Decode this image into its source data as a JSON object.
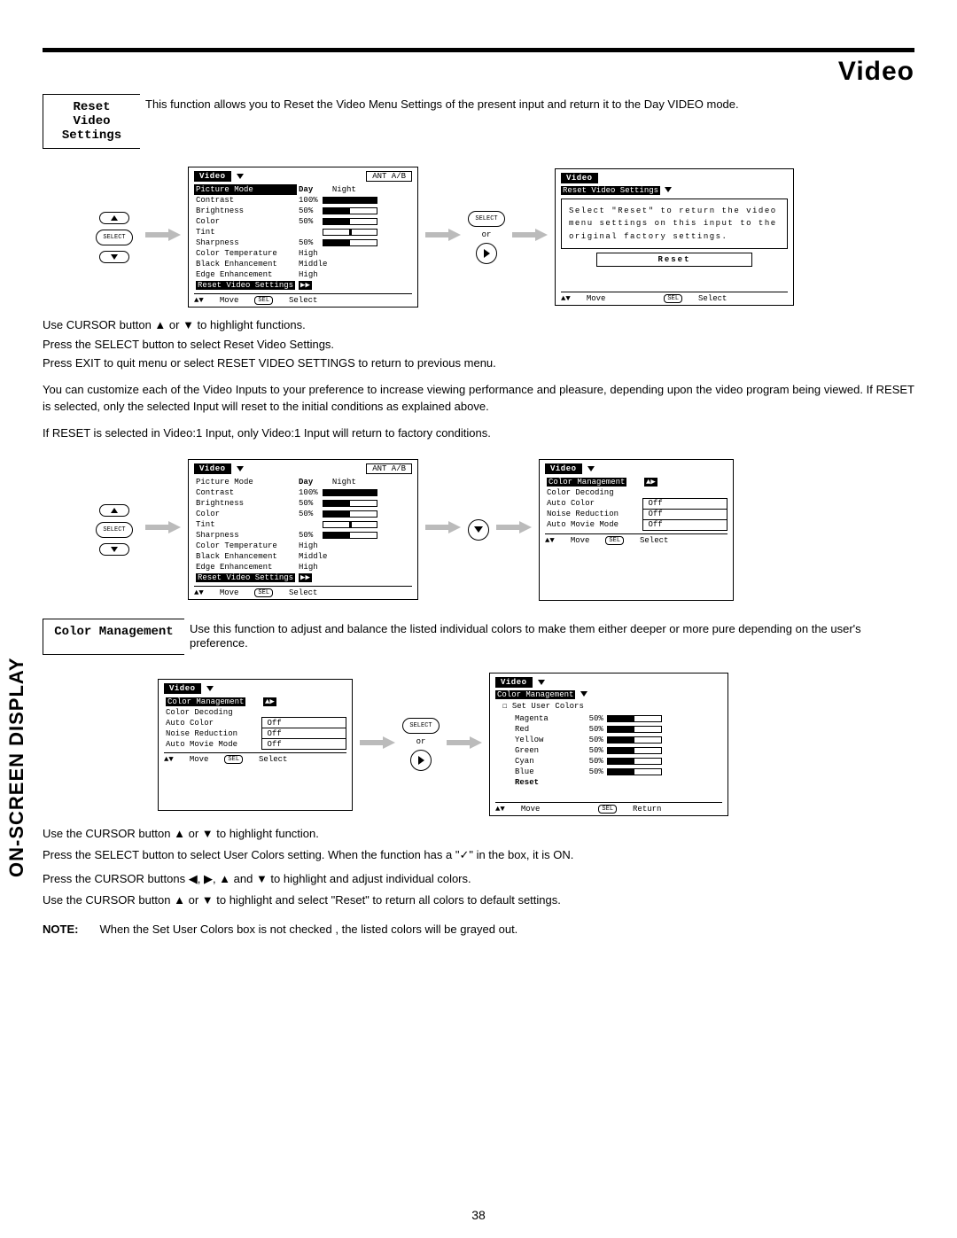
{
  "page": {
    "number": "38",
    "title": "Video",
    "sidebar": "ON-SCREEN DISPLAY"
  },
  "section1": {
    "heading": "Reset Video\nSettings",
    "intro": "This function allows you to Reset the Video Menu Settings of the present input and return it to the Day VIDEO mode.",
    "steps": [
      "Use CURSOR button ▲ or ▼ to highlight functions.",
      "Press the SELECT button to select Reset Video Settings.",
      "Press EXIT to quit menu or select RESET VIDEO SETTINGS to return to previous menu."
    ],
    "para1": "You can customize each of the Video Inputs to your preference to increase viewing performance and pleasure, depending upon the video program being viewed. If RESET is selected, only the selected Input will reset to the initial conditions as explained above.",
    "para2": "If RESET is selected in Video:1 Input, only Video:1 Input will return to factory conditions."
  },
  "osd_video": {
    "title": "Video",
    "source": "ANT A/B",
    "picture_mode_label": "Picture Mode",
    "day": "Day",
    "night": "Night",
    "rows": [
      {
        "label": "Contrast",
        "val": "100%",
        "pct": 100
      },
      {
        "label": "Brightness",
        "val": "50%",
        "pct": 50
      },
      {
        "label": "Color",
        "val": "50%",
        "pct": 50
      },
      {
        "label": "Tint",
        "val": "",
        "pct": null,
        "notch": 50
      },
      {
        "label": "Sharpness",
        "val": "50%",
        "pct": 50
      }
    ],
    "textrows": [
      {
        "label": "Color Temperature",
        "val": "High"
      },
      {
        "label": "Black Enhancement",
        "val": "Middle"
      },
      {
        "label": "Edge Enhancement",
        "val": "High"
      }
    ],
    "reset_label": "Reset Video Settings",
    "nav_move": "Move",
    "nav_select": "Select",
    "sel": "SEL",
    "updown": "▲▼"
  },
  "osd_reset": {
    "title": "Video",
    "sub": "Reset Video Settings",
    "msg": "Select \"Reset\" to return the video menu settings on this input to the original factory settings.",
    "reset": "Reset",
    "move": "Move",
    "select": "Select",
    "sel": "SEL"
  },
  "osd_cm_menu": {
    "title": "Video",
    "sub": "Color Management",
    "items": [
      {
        "label": "Color Decoding",
        "val": ""
      },
      {
        "label": "Auto Color",
        "val": "Off"
      },
      {
        "label": "Noise Reduction",
        "val": "Off"
      },
      {
        "label": "Auto Movie Mode",
        "val": "Off"
      }
    ],
    "nav_move": "Move",
    "nav_select": "Select",
    "sel": "SEL"
  },
  "osd_user_colors": {
    "title": "Video",
    "sub": "Color Management",
    "checkbox": "Set User Colors",
    "colors": [
      {
        "label": "Magenta",
        "val": "50%",
        "pct": 50
      },
      {
        "label": "Red",
        "val": "50%",
        "pct": 50
      },
      {
        "label": "Yellow",
        "val": "50%",
        "pct": 50
      },
      {
        "label": "Green",
        "val": "50%",
        "pct": 50
      },
      {
        "label": "Cyan",
        "val": "50%",
        "pct": 50
      },
      {
        "label": "Blue",
        "val": "50%",
        "pct": 50
      }
    ],
    "reset": "Reset",
    "move": "Move",
    "ret": "Return",
    "sel": "SEL"
  },
  "section2": {
    "heading": "Color Management",
    "intro": "Use this function to adjust and balance the listed individual colors to make them either deeper or more pure depending on the user's preference.",
    "steps": [
      "Use the CURSOR button ▲ or ▼ to highlight function.",
      "Press the SELECT button to select User Colors setting.  When the function has a \"✓\" in the box, it is ON.",
      "Press  the CURSOR buttons ◀, ▶, ▲ and ▼ to highlight and adjust individual colors.",
      "Use the CURSOR button ▲ or ▼ to highlight and select \"Reset\" to return all colors to default settings."
    ],
    "note_label": "NOTE:",
    "note": "When the Set User Colors box is not checked , the listed colors will be grayed out."
  },
  "remote": {
    "select": "SELECT",
    "or": "or"
  }
}
